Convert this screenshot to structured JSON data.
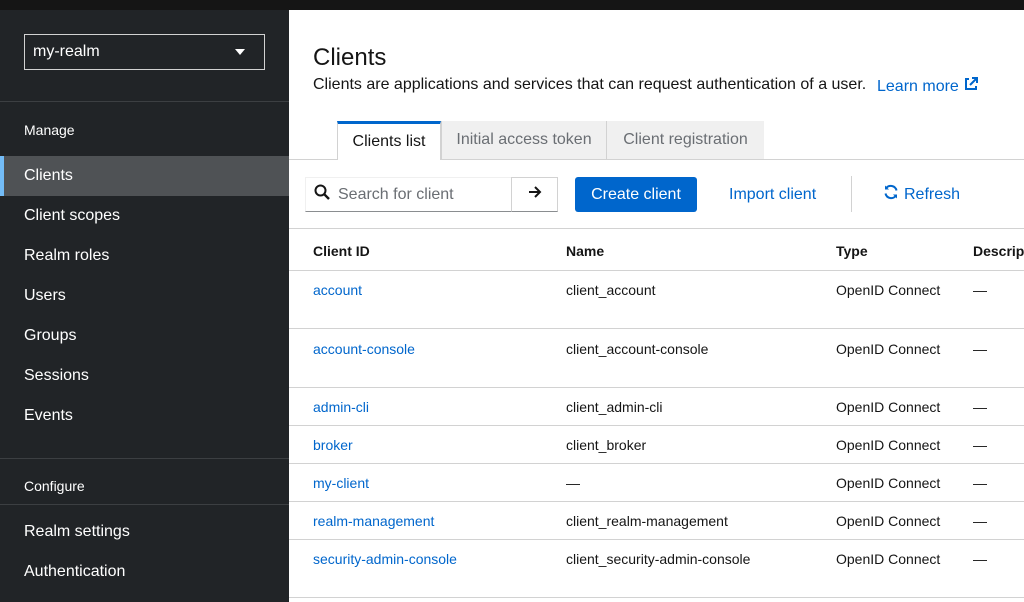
{
  "sidebar": {
    "realm": "my-realm",
    "sections": [
      {
        "title": "Manage"
      },
      {
        "title": "Configure"
      }
    ],
    "manage_items": [
      "Clients",
      "Client scopes",
      "Realm roles",
      "Users",
      "Groups",
      "Sessions",
      "Events"
    ],
    "configure_items": [
      "Realm settings",
      "Authentication"
    ],
    "active_item": "Clients"
  },
  "main": {
    "title": "Clients",
    "description": "Clients are applications and services that can request authentication of a user.",
    "learn_more": "Learn more",
    "tabs": [
      "Clients list",
      "Initial access token",
      "Client registration"
    ],
    "active_tab": "Clients list",
    "toolbar": {
      "search_placeholder": "Search for client",
      "create_label": "Create client",
      "import_label": "Import client",
      "refresh_label": "Refresh"
    },
    "table": {
      "columns": [
        "Client ID",
        "Name",
        "Type",
        "Descript"
      ],
      "rows": [
        {
          "client_id": "account",
          "name": "client_account",
          "type": "OpenID Connect",
          "description": "—"
        },
        {
          "client_id": "account-console",
          "name": "client_account-console",
          "type": "OpenID Connect",
          "description": "—"
        },
        {
          "client_id": "admin-cli",
          "name": "client_admin-cli",
          "type": "OpenID Connect",
          "description": "—"
        },
        {
          "client_id": "broker",
          "name": "client_broker",
          "type": "OpenID Connect",
          "description": "—"
        },
        {
          "client_id": "my-client",
          "name": "—",
          "type": "OpenID Connect",
          "description": "—"
        },
        {
          "client_id": "realm-management",
          "name": "client_realm-management",
          "type": "OpenID Connect",
          "description": "—"
        },
        {
          "client_id": "security-admin-console",
          "name": "client_security-admin-console",
          "type": "OpenID Connect",
          "description": "—"
        }
      ]
    }
  },
  "colors": {
    "sidebar_bg": "#212427",
    "active_nav_bg": "#4f5255",
    "active_indicator": "#73bcf7",
    "primary": "#0066cc"
  },
  "icons": {
    "realm_dropdown": "caret-down-icon",
    "learn_more": "external-link-icon",
    "search": "search-icon",
    "search_go": "arrow-right-icon",
    "refresh": "refresh-icon"
  }
}
